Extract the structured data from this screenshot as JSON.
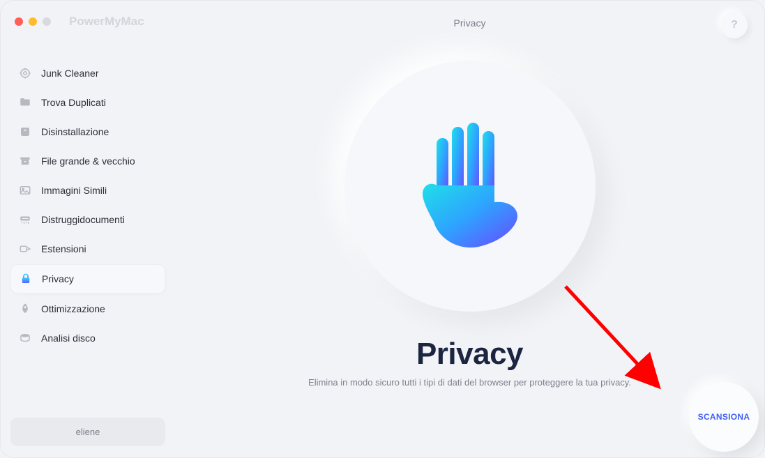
{
  "app": {
    "title": "PowerMyMac"
  },
  "sidebar": {
    "items": [
      {
        "label": "Junk Cleaner"
      },
      {
        "label": "Trova Duplicati"
      },
      {
        "label": "Disinstallazione"
      },
      {
        "label": "File grande & vecchio"
      },
      {
        "label": "Immagini Simili"
      },
      {
        "label": "Distruggidocumenti"
      },
      {
        "label": "Estensioni"
      },
      {
        "label": "Privacy"
      },
      {
        "label": "Ottimizzazione"
      },
      {
        "label": "Analisi disco"
      }
    ],
    "user": "eliene"
  },
  "header": {
    "title": "Privacy",
    "help": "?"
  },
  "main": {
    "heading": "Privacy",
    "subheading": "Elimina in modo sicuro tutti i tipi di dati del browser per proteggere la tua privacy.",
    "scan_label": "SCANSIONA"
  }
}
